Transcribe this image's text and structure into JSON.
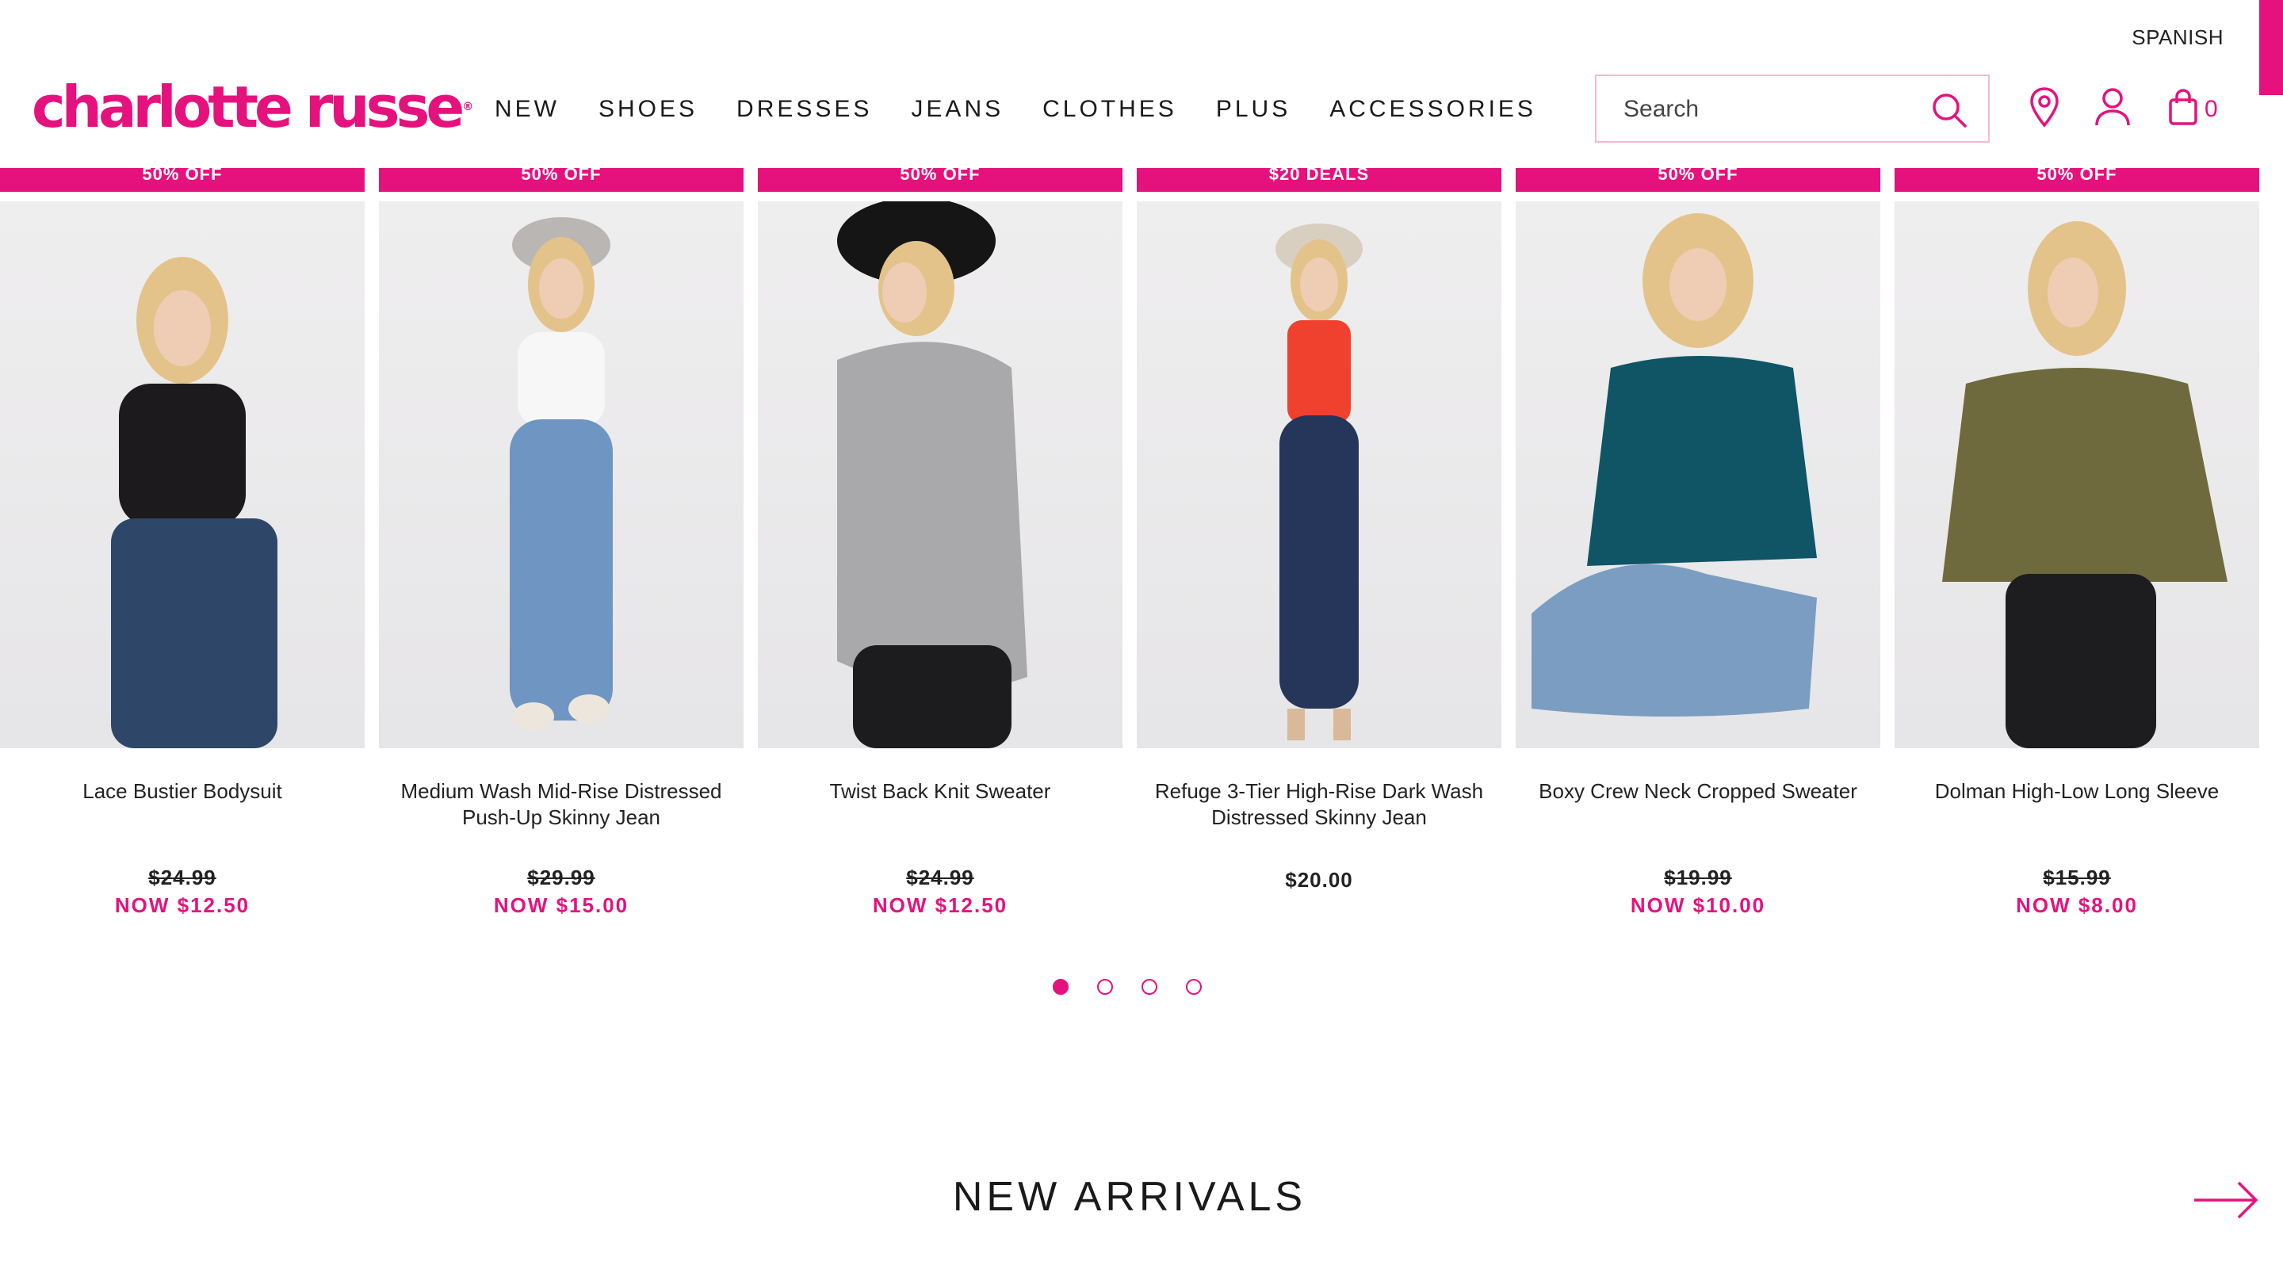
{
  "header": {
    "language_link": "SPANISH",
    "logo_text": "charlotte russe",
    "logo_mark": "®",
    "nav": [
      "NEW",
      "SHOES",
      "DRESSES",
      "JEANS",
      "CLOTHES",
      "PLUS",
      "ACCESSORIES"
    ],
    "search_placeholder": "Search",
    "cart_count": "0",
    "icons": [
      "search-icon",
      "store-locator-pin-icon",
      "account-user-icon",
      "shopping-bag-icon"
    ]
  },
  "products": [
    {
      "badge": "50% OFF",
      "name": "Lace Bustier Bodysuit",
      "original_price": "$24.99",
      "sale_price": "NOW $12.50",
      "top_color": "#1c1a1c",
      "bottom_color": "#2e4769"
    },
    {
      "badge": "50% OFF",
      "name": "Medium Wash Mid-Rise Distressed Push-Up Skinny Jean",
      "original_price": "$29.99",
      "sale_price": "NOW $15.00",
      "top_color": "#f7f7f7",
      "bottom_color": "#6f95c2"
    },
    {
      "badge": "50% OFF",
      "name": "Twist Back Knit Sweater",
      "original_price": "$24.99",
      "sale_price": "NOW $12.50",
      "top_color": "#a9a8aa",
      "bottom_color": "#1c1c1e"
    },
    {
      "badge": "$20 DEALS",
      "name": "Refuge 3-Tier High-Rise Dark Wash Distressed Skinny Jean",
      "original_price": "",
      "sale_price": "",
      "price": "$20.00",
      "top_color": "#f0412e",
      "bottom_color": "#25365a"
    },
    {
      "badge": "50% OFF",
      "name": "Boxy Crew Neck Cropped Sweater",
      "original_price": "$19.99",
      "sale_price": "NOW $10.00",
      "top_color": "#0f5566",
      "bottom_color": "#7c9dc2"
    },
    {
      "badge": "50% OFF",
      "name": "Dolman High-Low Long Sleeve",
      "original_price": "$15.99",
      "sale_price": "NOW $8.00",
      "top_color": "#6e6a3e",
      "bottom_color": "#1d1c1e"
    }
  ],
  "carousel": {
    "pages": 4,
    "active_page": 1
  },
  "section": {
    "title": "NEW ARRIVALS"
  },
  "colors": {
    "brand": "#e5127d",
    "text": "#1a1a1a"
  }
}
